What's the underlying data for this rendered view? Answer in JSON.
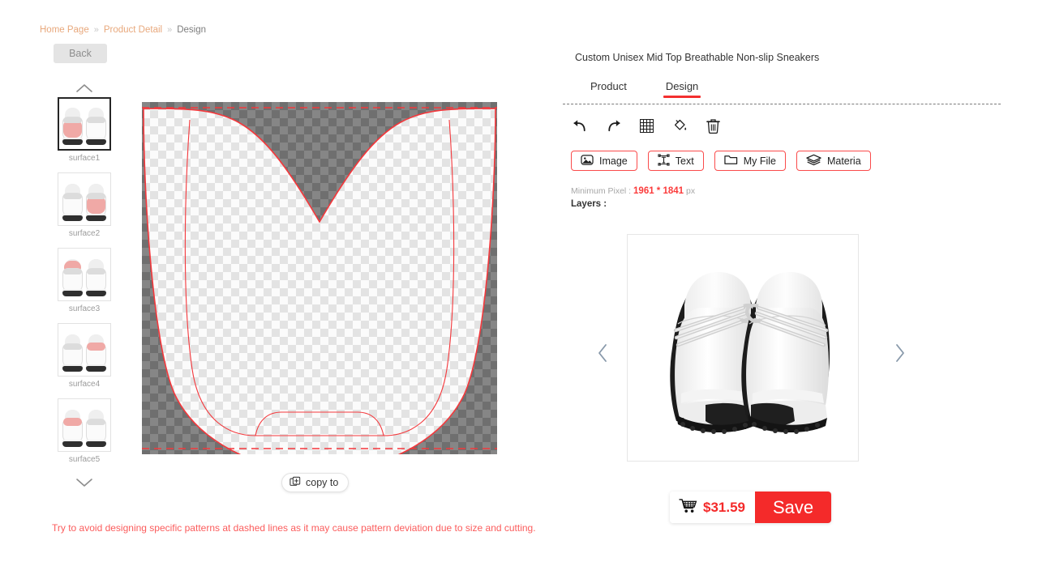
{
  "breadcrumb": {
    "items": [
      {
        "label": "Home Page",
        "link": true
      },
      {
        "label": "Product Detail",
        "link": true
      },
      {
        "label": "Design",
        "link": false
      }
    ],
    "separator": "»"
  },
  "back_button": {
    "label": "Back"
  },
  "surfaces": {
    "scroll_up_icon": "chevron-up-icon",
    "scroll_down_icon": "chevron-down-icon",
    "selected_index": 0,
    "items": [
      {
        "label": "surface1",
        "accent_area": "low"
      },
      {
        "label": "surface2",
        "accent_area": "low"
      },
      {
        "label": "surface3",
        "accent_area": "top"
      },
      {
        "label": "surface4",
        "accent_area": "top"
      },
      {
        "label": "surface5",
        "accent_area": "heel"
      }
    ]
  },
  "canvas": {
    "copy_to_label": "copy to",
    "copy_to_icon": "copy-icon",
    "warning_text": "Try to avoid designing specific patterns at dashed lines as it may cause pattern deviation due to size and cutting.",
    "outline_color": "#f4383c",
    "dashed_guide_color": "#f4383c"
  },
  "product": {
    "title": "Custom Unisex Mid Top Breathable Non-slip Sneakers"
  },
  "tabs": [
    {
      "label": "Product",
      "active": false
    },
    {
      "label": "Design",
      "active": true
    }
  ],
  "toolbar": [
    {
      "name": "undo-icon",
      "label": "Undo"
    },
    {
      "name": "redo-icon",
      "label": "Redo"
    },
    {
      "name": "grid-icon",
      "label": "Grid"
    },
    {
      "name": "fill-bucket-icon",
      "label": "Fill"
    },
    {
      "name": "trash-icon",
      "label": "Delete"
    }
  ],
  "actions": [
    {
      "label": "Image",
      "icon": "image-icon"
    },
    {
      "label": "Text",
      "icon": "text-box-icon"
    },
    {
      "label": "My File",
      "icon": "folder-icon"
    },
    {
      "label": "Materia",
      "icon": "layers-icon"
    }
  ],
  "info": {
    "min_pixel_label": "Minimum Pixel :",
    "min_pixel_value": "1961 * 1841",
    "min_pixel_unit": "px",
    "layers_label": "Layers :"
  },
  "preview": {
    "prev_icon": "chevron-left-icon",
    "next_icon": "chevron-right-icon",
    "alt": "white sneakers front view"
  },
  "purchase": {
    "cart_icon": "shopping-cart-icon",
    "price": "$31.59",
    "save_label": "Save"
  },
  "colors": {
    "accent_red": "#f42a2a",
    "breadcrumb_link": "#e8a87c",
    "warning": "#fb5c5c"
  }
}
